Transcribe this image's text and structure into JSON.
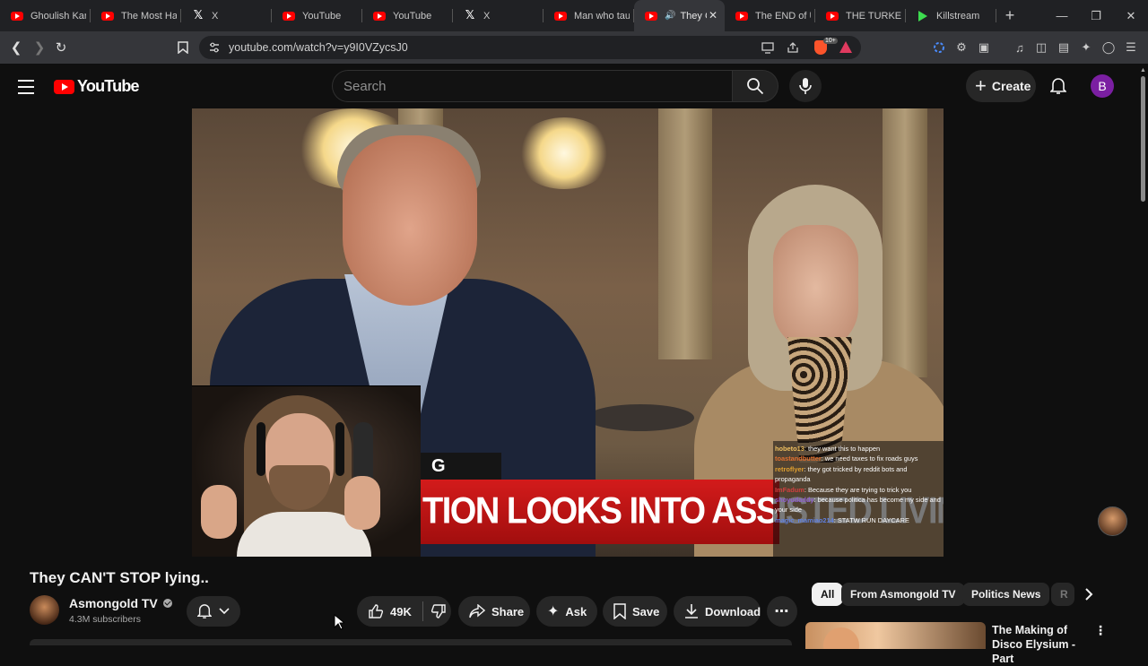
{
  "browser": {
    "tabs": [
      {
        "title": "Ghoulish Kar",
        "favicon": "youtube-icon",
        "active": false
      },
      {
        "title": "The Most Ha",
        "favicon": "youtube-icon",
        "active": false
      },
      {
        "title": "X",
        "favicon": "x-icon",
        "active": false
      },
      {
        "title": "YouTube",
        "favicon": "youtube-icon",
        "active": false
      },
      {
        "title": "YouTube",
        "favicon": "youtube-icon",
        "active": false
      },
      {
        "title": "X",
        "favicon": "x-icon",
        "active": false
      },
      {
        "title": "Man who tau",
        "favicon": "youtube-icon",
        "active": false
      },
      {
        "title": "They C",
        "favicon": "youtube-icon",
        "active": true
      },
      {
        "title": "The END of U",
        "favicon": "youtube-icon",
        "active": false
      },
      {
        "title": "THE TURKEY",
        "favicon": "youtube-icon",
        "active": false
      },
      {
        "title": "Killstream",
        "favicon": "kill-icon",
        "active": false
      }
    ],
    "url": "youtube.com/watch?v=y9I0VZycsJ0",
    "brave_badge": "10+"
  },
  "youtube": {
    "logo_text": "YouTube",
    "search_placeholder": "Search",
    "create_label": "Create",
    "avatar_letter": "B",
    "accent_red": "#ff0000"
  },
  "video": {
    "title": "They CAN'T STOP lying..",
    "headline_tag": "G NEWS",
    "headline_text": "TION LOOKS INTO ASSISTED LIVING SI",
    "chat": [
      {
        "user": "hobeto13",
        "color": "#f0c060",
        "text": "they want this to happen"
      },
      {
        "user": "toastandbutter",
        "color": "#e07030",
        "text": "we need taxes to fix roads guys"
      },
      {
        "user": "retroflyer",
        "color": "#e0a030",
        "text": "they got tricked by reddit bots and propaganda"
      },
      {
        "user": "ImFadum",
        "color": "#d04040",
        "text": "Because they are trying to trick you"
      },
      {
        "user": "shoyudaddy",
        "color": "#9060d0",
        "text": "because politica has become my side and your side"
      },
      {
        "user": "magic_mamiao214",
        "color": "#6080e0",
        "text": "STATW RUN DAYCARE"
      }
    ]
  },
  "channel": {
    "name": "Asmongold TV",
    "subscribers": "4.3M subscribers"
  },
  "actions": {
    "likes": "49K",
    "share": "Share",
    "ask": "Ask",
    "save": "Save",
    "download": "Download"
  },
  "chips": [
    "All",
    "From Asmongold TV",
    "Politics News",
    "R"
  ],
  "recommendation": {
    "title": "The Making of Disco Elysium - Part"
  }
}
